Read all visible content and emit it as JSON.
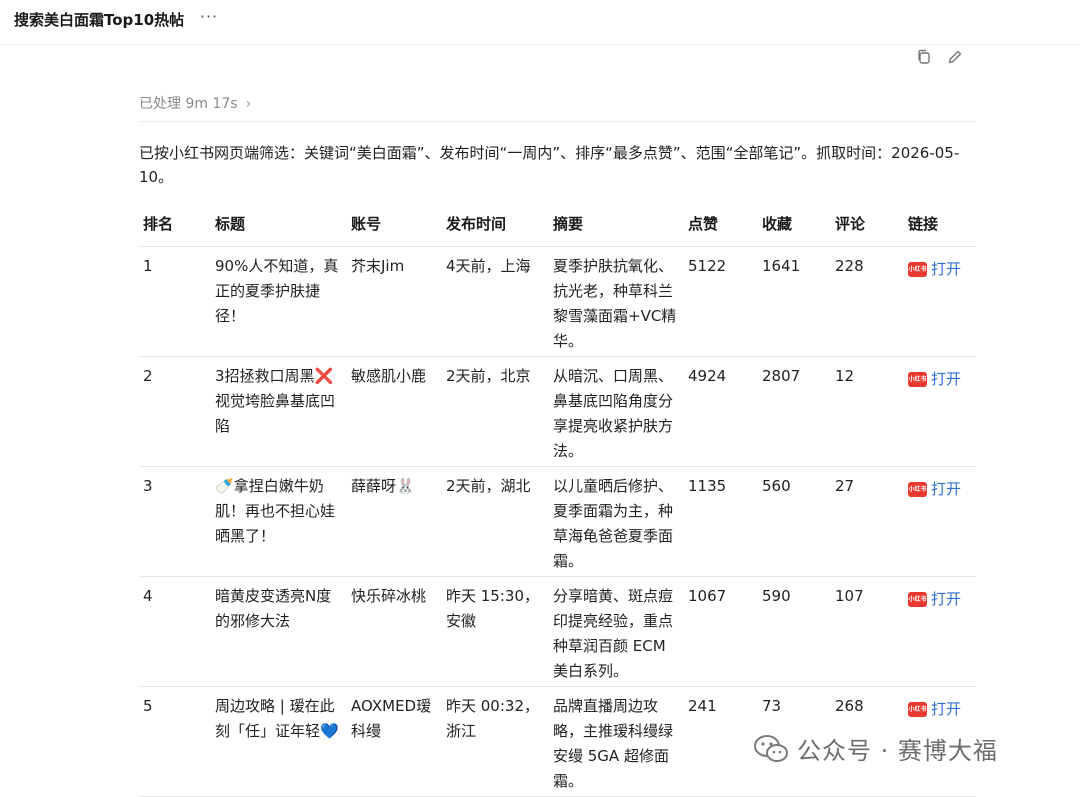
{
  "header": {
    "title": "搜索美白面霜Top10热帖",
    "more_label": "···"
  },
  "actions": {
    "copy_icon": "copy-icon",
    "edit_icon": "edit-icon"
  },
  "processing": {
    "label": "已处理 9m 17s",
    "chevron": "›"
  },
  "intro_text": "已按小红书网页端筛选：关键词“美白面霜”、发布时间“一周内”、排序“最多点赞”、范围“全部笔记”。抓取时间：2026-05-10。",
  "table": {
    "columns": [
      "排名",
      "标题",
      "账号",
      "发布时间",
      "摘要",
      "点赞",
      "收藏",
      "评论",
      "链接"
    ],
    "link_badge": "小红书",
    "rows": [
      {
        "rank": "1",
        "title": "90%人不知道，真正的夏季护肤捷径！",
        "account": "芥末Jim",
        "time": "4天前，上海",
        "summary": "夏季护肤抗氧化、抗光老，种草科兰黎雪藻面霜+VC精华。",
        "likes": "5122",
        "favorites": "1641",
        "comments": "228",
        "link": "打开"
      },
      {
        "rank": "2",
        "title": "3招拯救口周黑",
        "title_emoji": "❌",
        "title_rest": "视觉垮脸鼻基底凹陷",
        "account": "敏感肌小鹿",
        "time": "2天前，北京",
        "summary": "从暗沉、口周黑、鼻基底凹陷角度分享提亮收紧护肤方法。",
        "likes": "4924",
        "favorites": "2807",
        "comments": "12",
        "link": "打开"
      },
      {
        "rank": "3",
        "title_emoji": "🍼",
        "title": "拿捏白嫩牛奶肌！再也不担心娃晒黑了！",
        "account": "薛薛呀🐰",
        "time": "2天前，湖北",
        "summary": "以儿童晒后修护、夏季面霜为主，种草海龟爸爸夏季面霜。",
        "likes": "1135",
        "favorites": "560",
        "comments": "27",
        "link": "打开"
      },
      {
        "rank": "4",
        "title": "暗黄皮变透亮N度的邪修大法",
        "account": "快乐碎冰桃",
        "time": "昨天 15:30，安徽",
        "summary": "分享暗黄、斑点痘印提亮经验，重点种草润百颜 ECM 美白系列。",
        "likes": "1067",
        "favorites": "590",
        "comments": "107",
        "link": "打开"
      },
      {
        "rank": "5",
        "title": "周边攻略 | 瑷在此刻「任」证年轻",
        "title_emoji": "💙",
        "account": "AOXMED瑷科缦",
        "time": "昨天 00:32，浙江",
        "summary": "品牌直播周边攻略，主推瑷科缦绿安缦 5GA 超修面霜。",
        "likes": "241",
        "favorites": "73",
        "comments": "268",
        "link": "打开"
      }
    ]
  },
  "watermark": {
    "text": "公众号 · 赛博大福",
    "icon": "wechat-icon"
  }
}
